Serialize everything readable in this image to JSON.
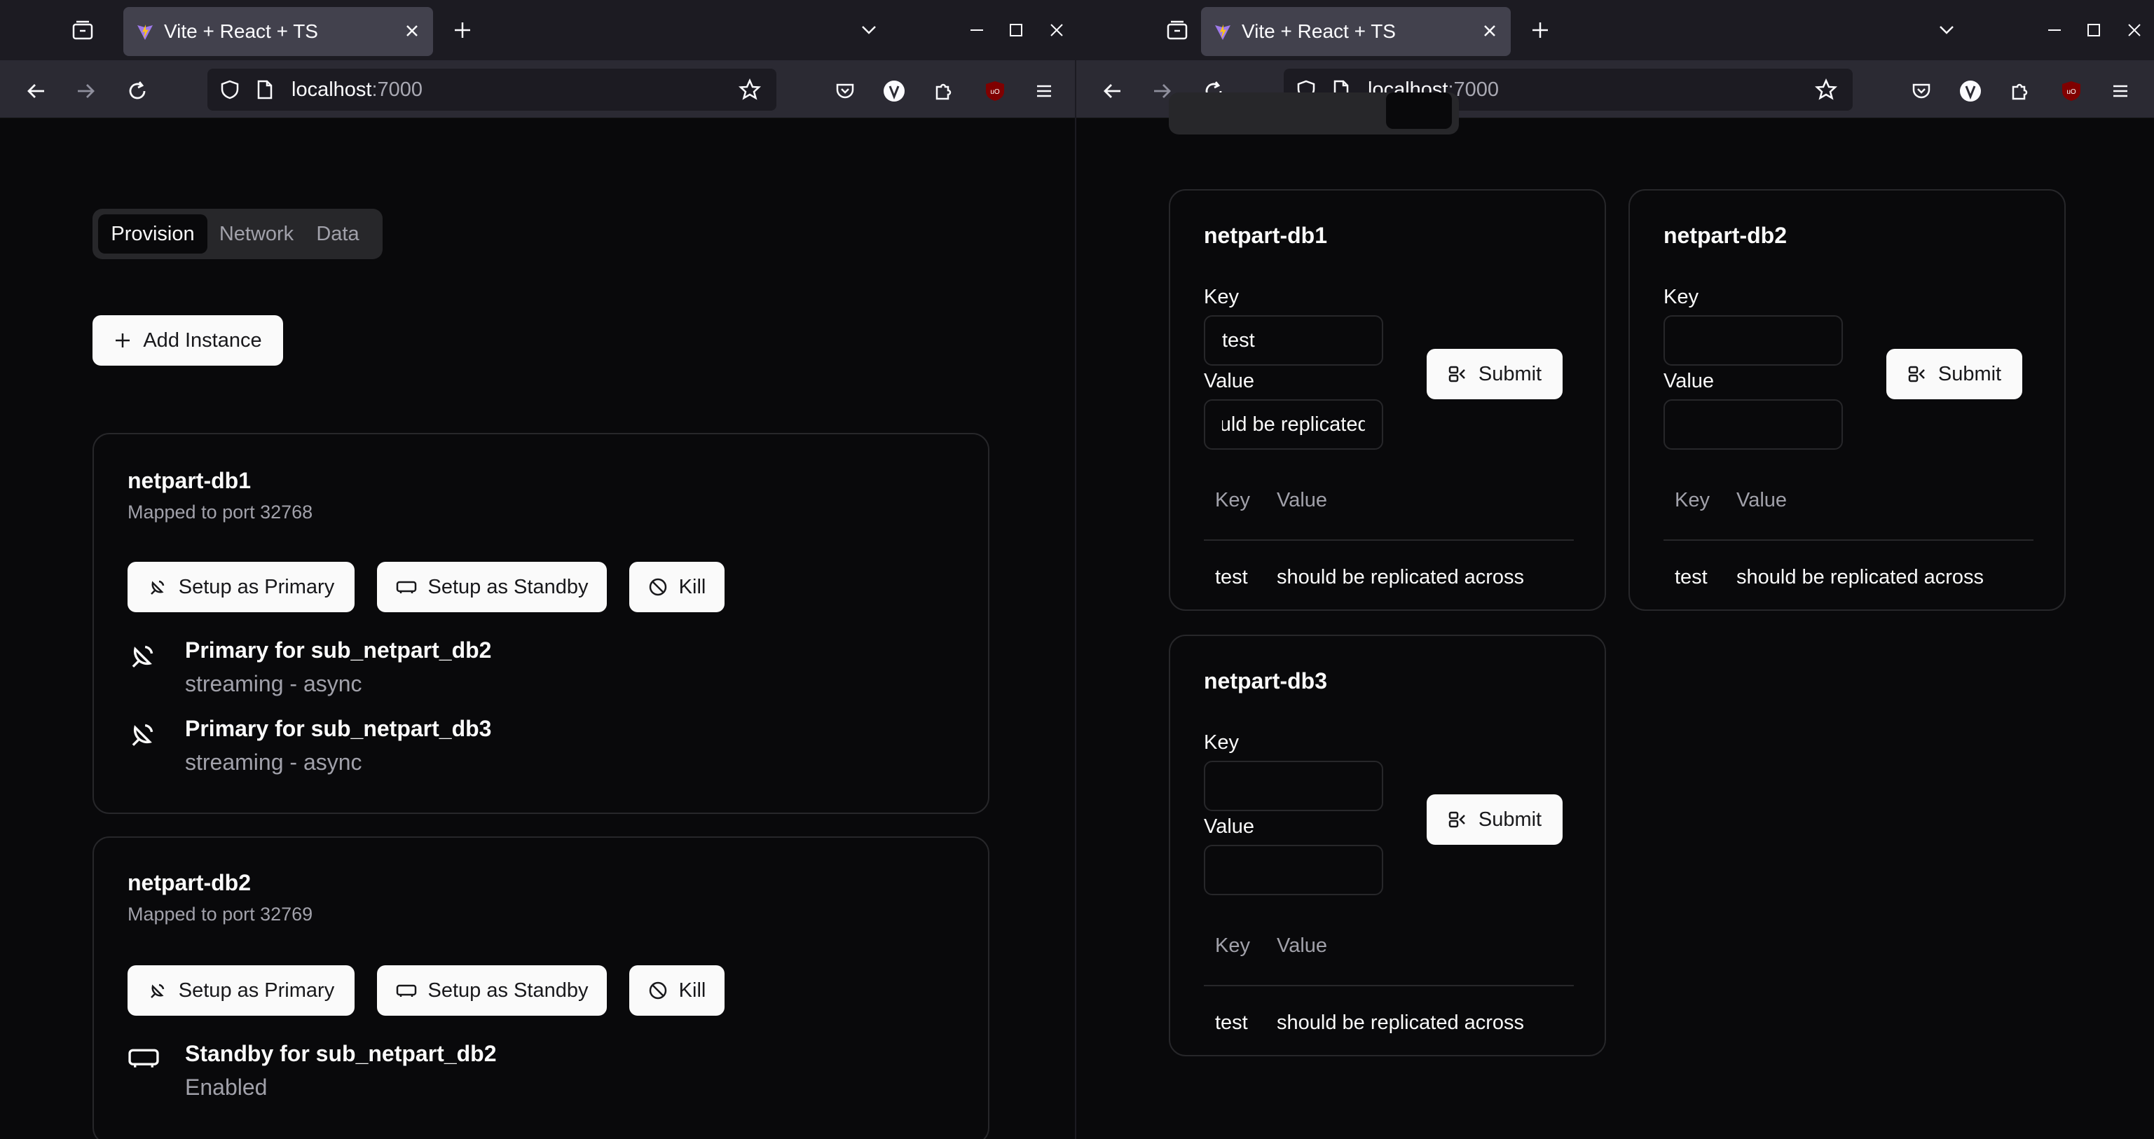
{
  "browser": {
    "tab_title": "Vite + React + TS",
    "url_host": "localhost",
    "url_port": ":7000"
  },
  "provision": {
    "tabs": [
      "Provision",
      "Network",
      "Data"
    ],
    "add_instance_label": "Add Instance",
    "actions": {
      "primary": "Setup as Primary",
      "standby": "Setup as Standby",
      "kill": "Kill"
    },
    "instances": [
      {
        "name": "netpart-db1",
        "port_text": "Mapped to port 32768",
        "replication": [
          {
            "icon": "satellite-dish-icon",
            "title": "Primary for sub_netpart_db2",
            "status": "streaming - async"
          },
          {
            "icon": "satellite-dish-icon",
            "title": "Primary for sub_netpart_db3",
            "status": "streaming - async"
          }
        ]
      },
      {
        "name": "netpart-db2",
        "port_text": "Mapped to port 32769",
        "replication": [
          {
            "icon": "server-icon",
            "title": "Standby for sub_netpart_db2",
            "status": "Enabled"
          }
        ]
      }
    ]
  },
  "data_page": {
    "labels": {
      "key": "Key",
      "value": "Value",
      "submit": "Submit",
      "col_key": "Key",
      "col_value": "Value"
    },
    "databases": [
      {
        "name": "netpart-db1",
        "key_input": "test",
        "value_input": "should be replicated across",
        "rows": [
          {
            "key": "test",
            "value": "should be replicated across"
          }
        ]
      },
      {
        "name": "netpart-db2",
        "key_input": "",
        "value_input": "",
        "rows": [
          {
            "key": "test",
            "value": "should be replicated across"
          }
        ]
      },
      {
        "name": "netpart-db3",
        "key_input": "",
        "value_input": "",
        "rows": [
          {
            "key": "test",
            "value": "should be replicated across"
          }
        ]
      }
    ]
  }
}
